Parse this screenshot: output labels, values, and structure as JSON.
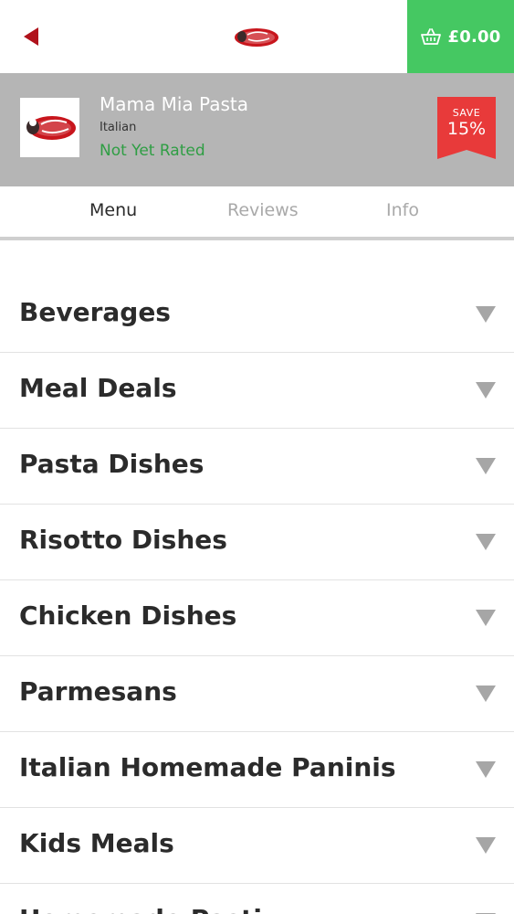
{
  "header": {
    "back_icon": "back-arrow-icon",
    "logo_icon": "restaurant-logo-icon",
    "cart": {
      "icon": "basket-icon",
      "total": "£0.00"
    }
  },
  "restaurant": {
    "name": "Mama Mia Pasta",
    "cuisine": "Italian",
    "rating": "Not Yet Rated",
    "badge": {
      "label": "SAVE",
      "value": "15%"
    }
  },
  "tabs": [
    {
      "label": "Menu",
      "active": true
    },
    {
      "label": "Reviews",
      "active": false
    },
    {
      "label": "Info",
      "active": false
    }
  ],
  "menu": {
    "categories": [
      {
        "label": "Beverages"
      },
      {
        "label": "Meal Deals"
      },
      {
        "label": "Pasta Dishes"
      },
      {
        "label": "Risotto Dishes"
      },
      {
        "label": "Chicken Dishes"
      },
      {
        "label": "Parmesans"
      },
      {
        "label": "Italian Homemade Paninis"
      },
      {
        "label": "Kids Meals"
      },
      {
        "label": "Homemade Pasti..."
      }
    ]
  },
  "colors": {
    "accent_green": "#45c862",
    "rating_green": "#2f9e44",
    "badge_red": "#e83a3a",
    "header_grey": "#b5b5b5",
    "back_red": "#b0121b"
  }
}
